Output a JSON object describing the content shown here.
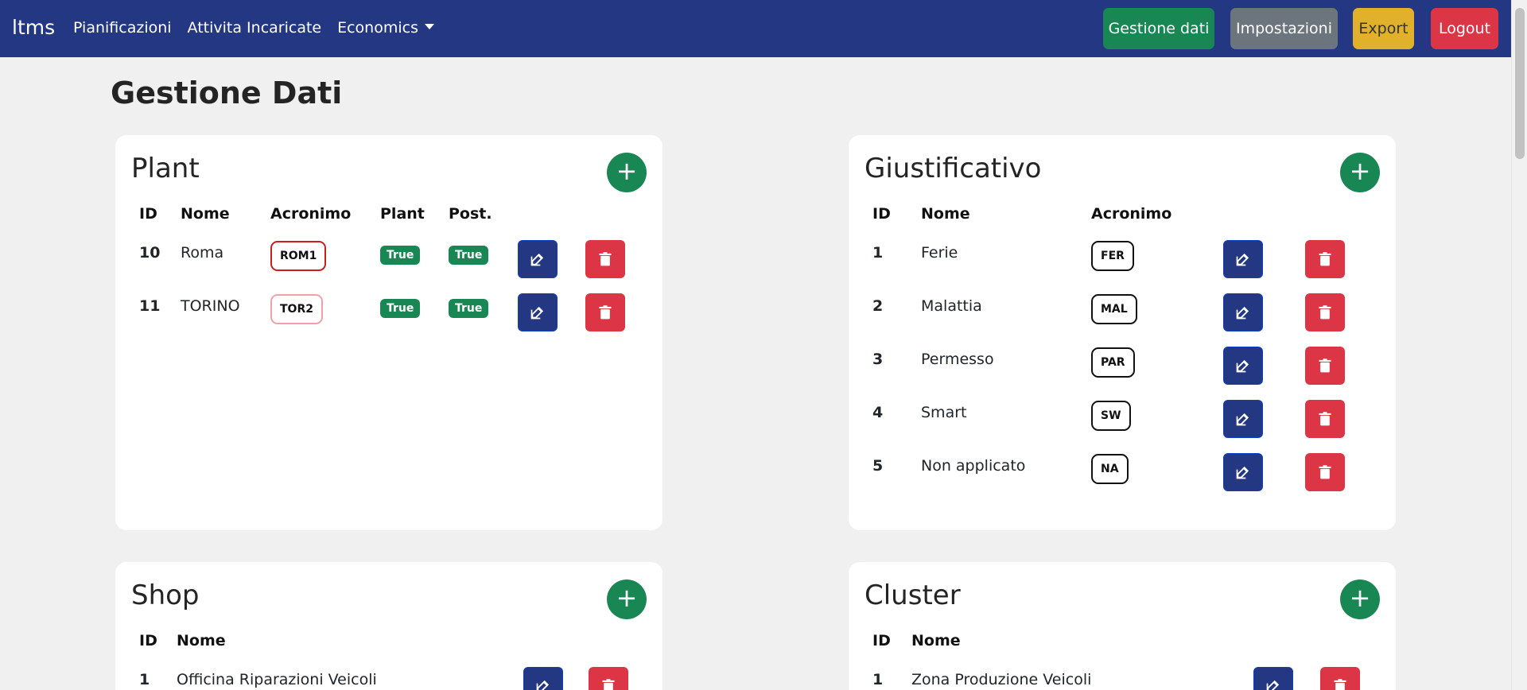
{
  "navbar": {
    "brand": "ltms",
    "links": [
      "Pianificazioni",
      "Attivita Incaricate",
      "Economics"
    ],
    "buttons": {
      "gestione": "Gestione dati",
      "impostazioni": "Impostazioni",
      "export": "Export",
      "logout": "Logout"
    }
  },
  "page_title": "Gestione Dati",
  "plant": {
    "title": "Plant",
    "headers": [
      "ID",
      "Nome",
      "Acronimo",
      "Plant",
      "Post."
    ],
    "rows": [
      {
        "id": "10",
        "nome": "Roma",
        "acronimo": "ROM1",
        "plant": "True",
        "post": "True",
        "acr_color": "#c81e1e"
      },
      {
        "id": "11",
        "nome": "TORINO",
        "acronimo": "TOR2",
        "plant": "True",
        "post": "True",
        "acr_color": "#f2a0a8"
      }
    ]
  },
  "giustificativo": {
    "title": "Giustificativo",
    "headers": [
      "ID",
      "Nome",
      "Acronimo"
    ],
    "rows": [
      {
        "id": "1",
        "nome": "Ferie",
        "acronimo": "FER"
      },
      {
        "id": "2",
        "nome": "Malattia",
        "acronimo": "MAL"
      },
      {
        "id": "3",
        "nome": "Permesso",
        "acronimo": "PAR"
      },
      {
        "id": "4",
        "nome": "Smart",
        "acronimo": "SW"
      },
      {
        "id": "5",
        "nome": "Non applicato",
        "acronimo": "NA"
      }
    ]
  },
  "shop": {
    "title": "Shop",
    "headers": [
      "ID",
      "Nome"
    ],
    "rows": [
      {
        "id": "1",
        "nome": "Officina Riparazioni Veicoli"
      }
    ]
  },
  "cluster": {
    "title": "Cluster",
    "headers": [
      "ID",
      "Nome"
    ],
    "rows": [
      {
        "id": "1",
        "nome": "Zona Produzione Veicoli"
      }
    ]
  },
  "icons": {
    "add": "plus-icon",
    "edit": "edit-icon",
    "delete": "trash-icon"
  },
  "colors": {
    "navbar": "#243782",
    "success": "#198754",
    "danger": "#dc3545",
    "secondary": "#6c757d",
    "warning": "#e1b12c",
    "primary_dark": "#243782"
  }
}
